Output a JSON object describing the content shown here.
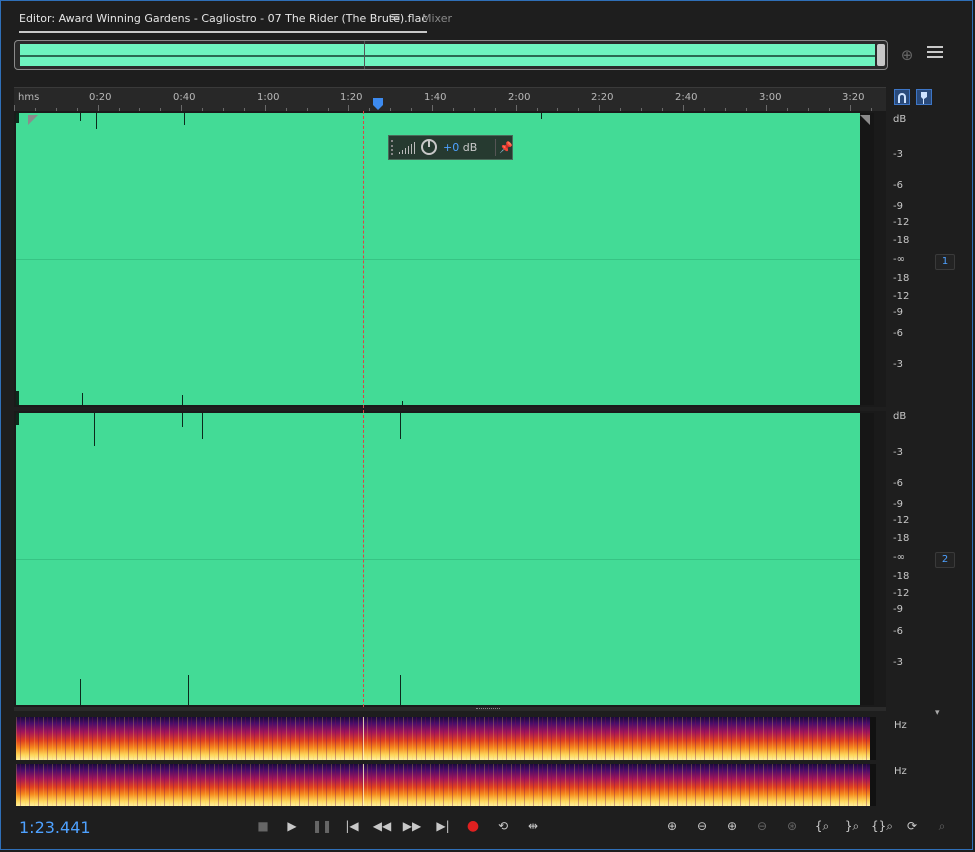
{
  "tabs": {
    "editor_label": "Editor: Award Winning Gardens - Cagliostro - 07 The Rider (The Brute).flac",
    "mixer_label": "Mixer"
  },
  "ruler": {
    "unit_label": "hms",
    "ticks": [
      "0:20",
      "0:40",
      "1:00",
      "1:20",
      "1:40",
      "2:00",
      "2:20",
      "2:40",
      "3:00",
      "3:20"
    ]
  },
  "hud": {
    "value": "+0",
    "unit": "dB"
  },
  "amplitude_scale": {
    "header": "dB",
    "labels": [
      "-3",
      "-6",
      "-9",
      "-12",
      "-18",
      "-∞",
      "-18",
      "-12",
      "-9",
      "-6",
      "-3"
    ]
  },
  "channels": [
    {
      "badge": "1"
    },
    {
      "badge": "2"
    }
  ],
  "spectral_scale": {
    "label": "Hz"
  },
  "status": {
    "current_time": "1:23.441"
  },
  "colors": {
    "waveform": "#43db96",
    "overview": "#6ef5bf",
    "accent": "#4ea1ff",
    "record": "#e02020"
  }
}
